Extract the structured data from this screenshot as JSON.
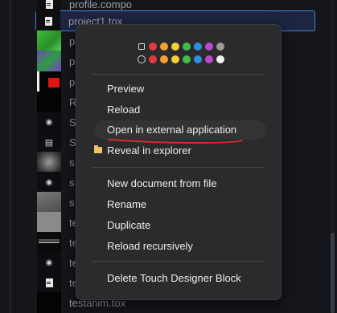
{
  "file_list": {
    "rows": [
      {
        "name": "profile.compo",
        "thumb": "doc-icon"
      },
      {
        "name": "project1.tox",
        "thumb": "doc-icon"
      },
      {
        "name": "p",
        "thumb": "green-image"
      },
      {
        "name": "p",
        "thumb": "green-image"
      },
      {
        "name": "p",
        "thumb": "red-white-image"
      },
      {
        "name": "R",
        "thumb": "black-image"
      },
      {
        "name": "S",
        "thumb": "face-icon"
      },
      {
        "name": "S",
        "thumb": "chip-icon"
      },
      {
        "name": "s",
        "thumb": "noise-image"
      },
      {
        "name": "s",
        "thumb": "face-icon"
      },
      {
        "name": "s",
        "thumb": "gray-image"
      },
      {
        "name": "te",
        "thumb": "gray-image"
      },
      {
        "name": "te",
        "thumb": "wave-image"
      },
      {
        "name": "te",
        "thumb": "face-icon"
      },
      {
        "name": "te",
        "thumb": "doc-icon"
      },
      {
        "name": "testanim.tox",
        "thumb": "black-image"
      }
    ]
  },
  "context_menu": {
    "color_swatches_row1": [
      "#ffffff00",
      "#e03a3a",
      "#f2a12f",
      "#f2d23a",
      "#3fbf4a",
      "#2f8fd8",
      "#b94ad0",
      "#9a9a9a"
    ],
    "color_swatches_row2": [
      "#ffffff00",
      "#e03a3a",
      "#f2a12f",
      "#f2d23a",
      "#3fbf4a",
      "#2f8fd8",
      "#b94ad0",
      "#f0f0f0"
    ],
    "items": {
      "preview": "Preview",
      "reload": "Reload",
      "open_external": "Open in external application",
      "reveal": "Reveal in explorer",
      "new_document": "New document from file",
      "rename": "Rename",
      "duplicate": "Duplicate",
      "reload_recursively": "Reload recursively",
      "delete": "Delete Touch Designer Block"
    }
  },
  "colors": {
    "selection_border": "#4a7fd6",
    "annotation_underline": "#d42a2a"
  }
}
